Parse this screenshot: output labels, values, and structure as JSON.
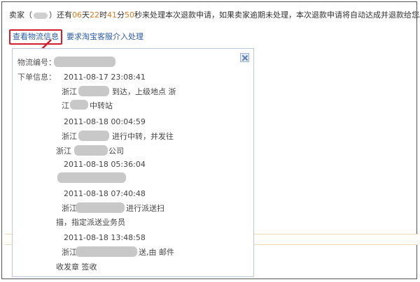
{
  "notice": {
    "seller_label": "卖家（",
    "seller_close": "）还有",
    "days": "06",
    "days_unit": "天",
    "hours": "22",
    "hours_unit": "时",
    "minutes": "41",
    "minutes_unit": "分",
    "seconds": "50",
    "rest": "秒来处理本次退款申请，如果卖家逾期未处理，本次退款申请将自动达成并退款给您。"
  },
  "links": {
    "view_logistics": "查看物流信息",
    "request_service": "要求淘宝客服介入处理"
  },
  "popup": {
    "tracking_label": "物流编号：",
    "order_label": "下单信息：",
    "entries": [
      {
        "time": "2011-08-17 23:08:41",
        "line1_a": "浙江",
        "line1_b": "到达，上级地点 浙",
        "line2_a": "江",
        "line2_b": "中转站"
      },
      {
        "time": "2011-08-18 00:04:59",
        "line1_a": "浙江",
        "line1_b": "进行中转，并发往",
        "line2_a": "浙江",
        "line2_b": "公司"
      },
      {
        "time": "2011-08-18 05:36:04"
      },
      {
        "time": "2011-08-18 07:40:48",
        "line1_a": "浙江",
        "line1_b": "进行派送扫",
        "line2_a": "描，指定派送业务员"
      },
      {
        "time": "2011-08-18 13:48:58",
        "line1_a": "浙江",
        "line1_b": "送,由 邮件",
        "line2_a": "收发章 签收"
      }
    ]
  }
}
